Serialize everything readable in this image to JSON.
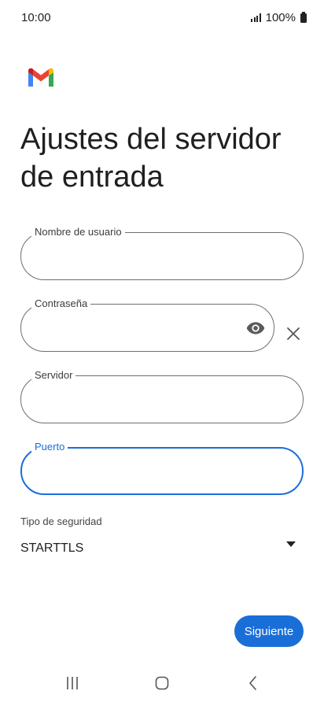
{
  "status_bar": {
    "time": "10:00",
    "battery": "100%"
  },
  "app": {
    "logo_icon": "gmail-logo",
    "accent_color": "#1a6ed8"
  },
  "page": {
    "title": "Ajustes del servidor de entrada"
  },
  "form": {
    "username": {
      "label": "Nombre de usuario",
      "value": ""
    },
    "password": {
      "label": "Contraseña",
      "value": "",
      "show_icon": "eye-icon",
      "clear_icon": "close-icon"
    },
    "server": {
      "label": "Servidor",
      "value": ""
    },
    "port": {
      "label": "Puerto",
      "value": "",
      "focused": true
    },
    "security": {
      "label": "Tipo de seguridad",
      "value": "STARTTLS",
      "icon": "dropdown-arrow-icon"
    }
  },
  "actions": {
    "next_label": "Siguiente"
  },
  "nav_bar": {
    "recents_icon": "recents-icon",
    "home_icon": "home-icon",
    "back_icon": "back-icon"
  }
}
